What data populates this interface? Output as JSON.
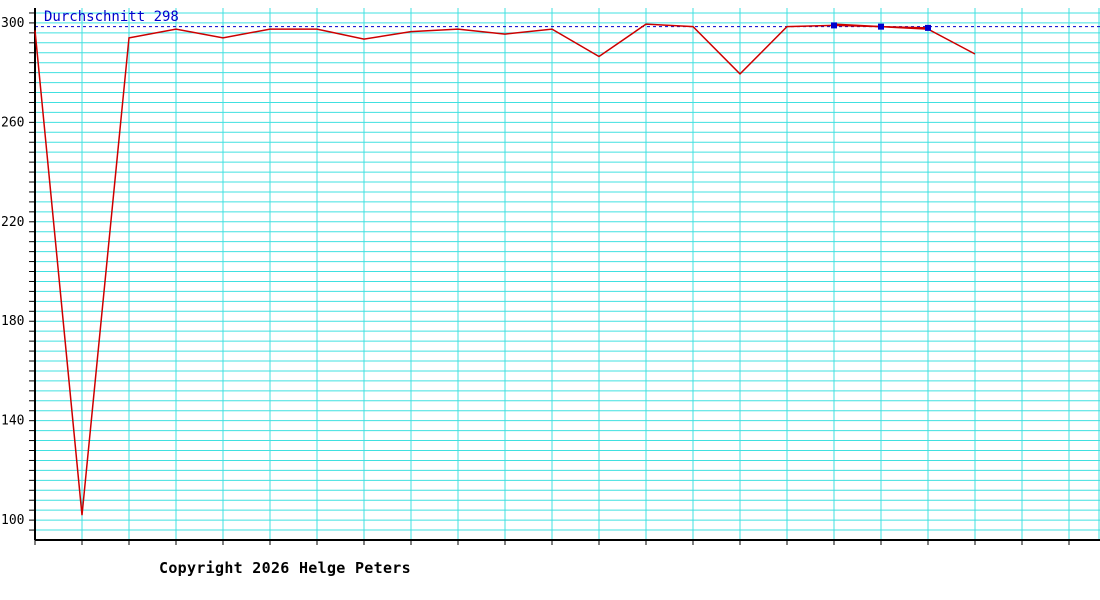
{
  "chart_data": {
    "type": "line",
    "ylim": [
      92,
      306
    ],
    "yticks": [
      100,
      140,
      180,
      220,
      260,
      300
    ],
    "yminor_step": 8,
    "x_count": 23,
    "grid": true,
    "average": {
      "label": "Durchschnitt 298",
      "value": 298.5
    },
    "series": [
      {
        "values": [
          297,
          102,
          294,
          297.5,
          294,
          297.5,
          297.5,
          293.5,
          296.5,
          297.5,
          295.5,
          297.5,
          286.5,
          299.5,
          298.5,
          279.5,
          298.5,
          299,
          298.5,
          298,
          null,
          null,
          null
        ]
      },
      {
        "values": [
          null,
          null,
          null,
          null,
          null,
          null,
          null,
          null,
          null,
          null,
          null,
          null,
          null,
          null,
          null,
          null,
          null,
          299.5,
          298.5,
          297.5,
          287.5,
          null,
          null
        ]
      }
    ],
    "highlight_points": [
      17,
      18,
      19
    ],
    "colors": {
      "grid": "#40e0e0",
      "line": "#cc0000",
      "avg": "#0000cc",
      "axis": "#000000"
    }
  },
  "footer": {
    "copyright": "Copyright 2026 Helge Peters"
  }
}
